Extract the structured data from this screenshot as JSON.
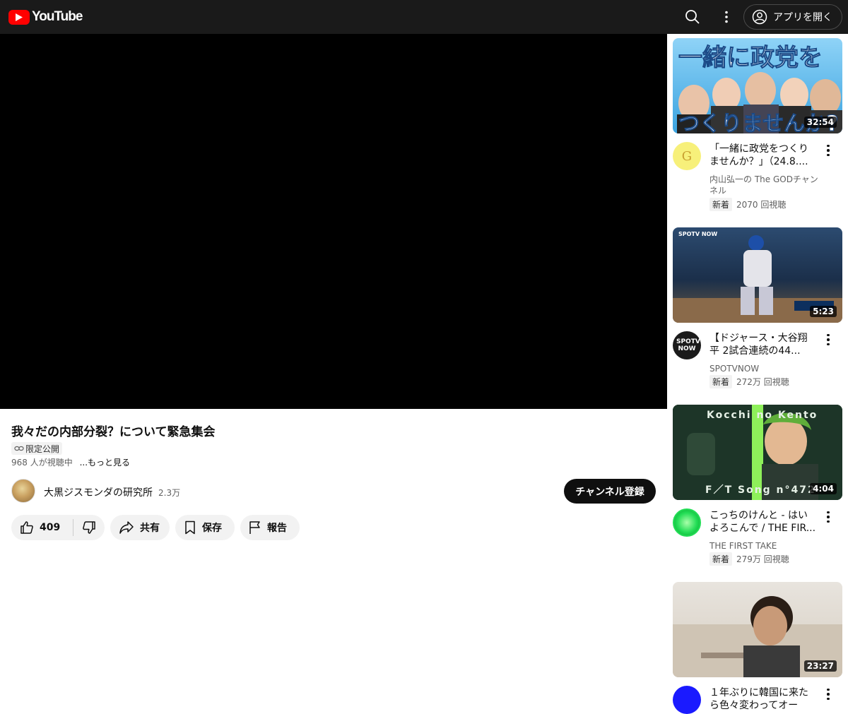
{
  "header": {
    "logo_text": "YouTube",
    "open_app_label": "アプリを開く"
  },
  "video": {
    "title": "我々だの内部分裂？について緊急集会",
    "visibility": "限定公開",
    "viewers": "968 人が視聴中",
    "more_label": "...もっと見る",
    "channel_name": "大黒ジスモンダの研究所",
    "subscribers": "2.3万",
    "subscribe_label": "チャンネル登録",
    "likes": "409",
    "share_label": "共有",
    "save_label": "保存",
    "report_label": "報告"
  },
  "recommendations": [
    {
      "thumb_text_top": "一緒に政党を",
      "thumb_text_bottom": "つくりませんか?",
      "duration": "32:54",
      "title_line1": "「一緒に政党をつくり",
      "title_line2": "ませんか？」（24.8....",
      "channel": "内山弘一の The GODチャンネル",
      "new_label": "新着",
      "views": "2070 回視聴",
      "avatar_letter": "G",
      "colors": {
        "thumb_bg": "#3aa3e0",
        "avatar": "#f7f07a"
      }
    },
    {
      "thumb_brand": "SPOTV NOW",
      "duration": "5:23",
      "title_line1": "【ドジャース・大谷翔",
      "title_line2": "平 2試合連続の44...",
      "channel": "SPOTVNOW",
      "new_label": "新着",
      "views": "272万 回視聴",
      "avatar_text": "SPOTV NOW",
      "colors": {
        "thumb_bg": "#1f3a5a",
        "avatar": "#1b1b1b"
      }
    },
    {
      "thumb_text_top": "Kocchi no Kento",
      "thumb_text_bottom": "F／T Song n°472",
      "duration": "4:04",
      "title_line1": "こっちのけんと - はい",
      "title_line2": "よろこんで / THE FIR...",
      "channel": "THE FIRST TAKE",
      "new_label": "新着",
      "views": "279万 回視聴",
      "colors": {
        "thumb_bg": "#2d4a3a",
        "avatar": "#22dd55"
      }
    },
    {
      "duration": "23:27",
      "title_line1": "１年ぶりに韓国に来た",
      "title_line2": "ら色々変わってオー",
      "colors": {
        "thumb_bg": "#d8d0c4",
        "avatar": "#1a1aff"
      }
    }
  ]
}
